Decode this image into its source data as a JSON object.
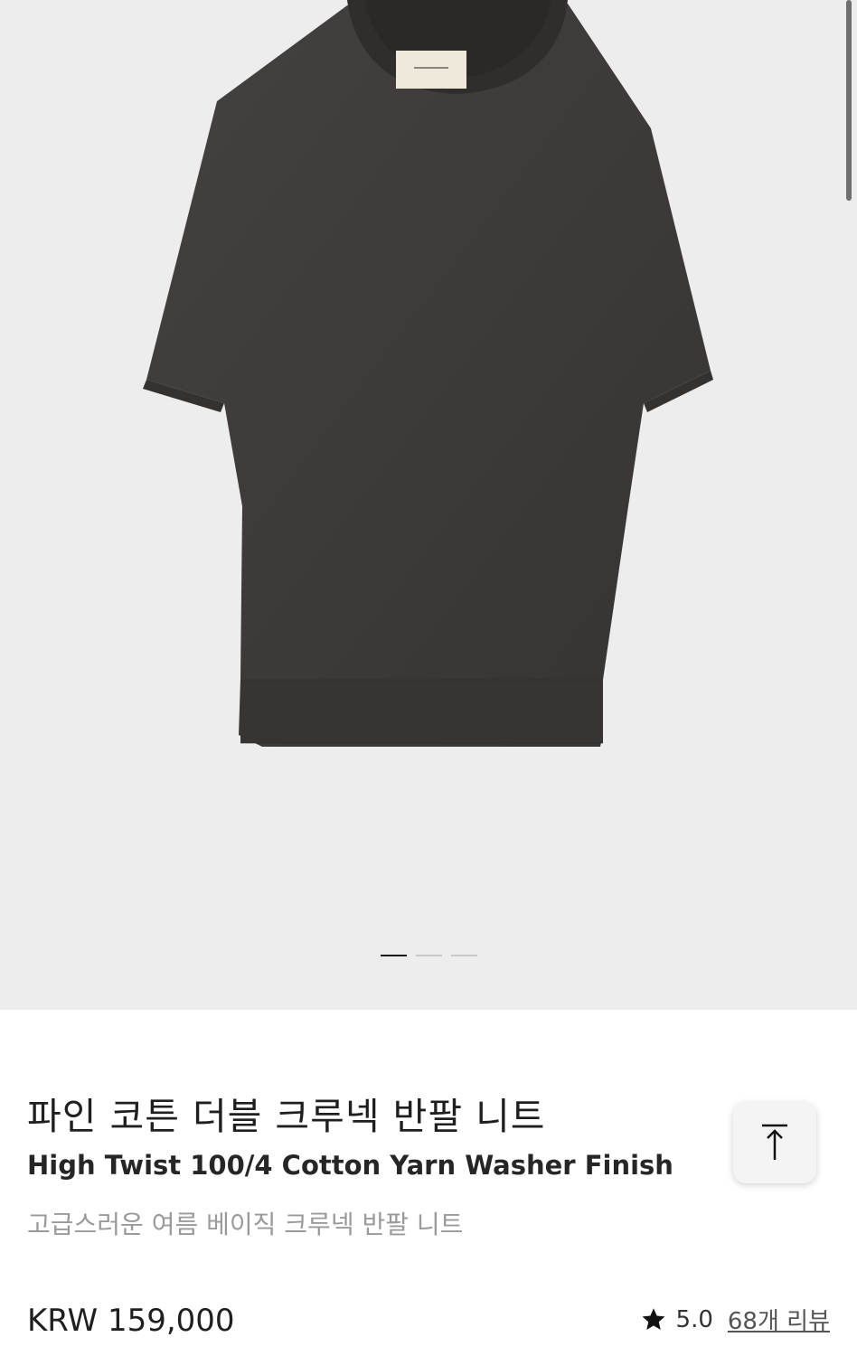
{
  "gallery": {
    "image_alt": "product-photo",
    "slide_count": 3,
    "active_slide": 0
  },
  "product": {
    "title_ko": "파인 코튼 더블 크루넥 반팔 니트",
    "title_en": "High Twist 100/4 Cotton Yarn Washer Finish",
    "subtitle": "고급스러운 여름 베이직 크루넥 반팔 니트",
    "price": "KRW 159,000",
    "rating": "5.0",
    "reviews": "68개 리뷰"
  },
  "icons": {
    "star": "star-icon",
    "scroll_top": "arrow-up-icon"
  },
  "colors": {
    "gallery_bg": "#ededed",
    "garment": "#3f3c3a",
    "text_primary": "#1f1f1f",
    "text_muted": "#9a9a9a"
  }
}
